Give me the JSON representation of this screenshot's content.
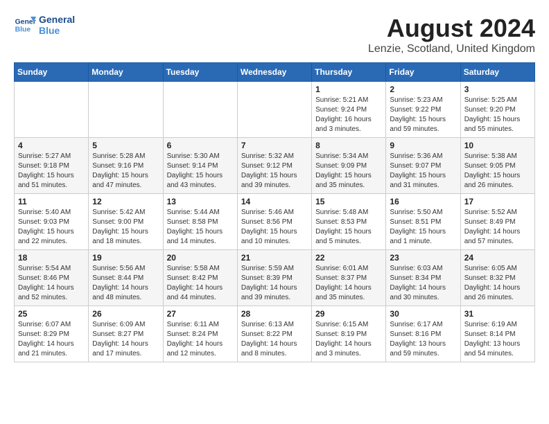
{
  "header": {
    "logo_line1": "General",
    "logo_line2": "Blue",
    "month_year": "August 2024",
    "location": "Lenzie, Scotland, United Kingdom"
  },
  "days_of_week": [
    "Sunday",
    "Monday",
    "Tuesday",
    "Wednesday",
    "Thursday",
    "Friday",
    "Saturday"
  ],
  "weeks": [
    [
      {
        "day": "",
        "content": ""
      },
      {
        "day": "",
        "content": ""
      },
      {
        "day": "",
        "content": ""
      },
      {
        "day": "",
        "content": ""
      },
      {
        "day": "1",
        "content": "Sunrise: 5:21 AM\nSunset: 9:24 PM\nDaylight: 16 hours\nand 3 minutes."
      },
      {
        "day": "2",
        "content": "Sunrise: 5:23 AM\nSunset: 9:22 PM\nDaylight: 15 hours\nand 59 minutes."
      },
      {
        "day": "3",
        "content": "Sunrise: 5:25 AM\nSunset: 9:20 PM\nDaylight: 15 hours\nand 55 minutes."
      }
    ],
    [
      {
        "day": "4",
        "content": "Sunrise: 5:27 AM\nSunset: 9:18 PM\nDaylight: 15 hours\nand 51 minutes."
      },
      {
        "day": "5",
        "content": "Sunrise: 5:28 AM\nSunset: 9:16 PM\nDaylight: 15 hours\nand 47 minutes."
      },
      {
        "day": "6",
        "content": "Sunrise: 5:30 AM\nSunset: 9:14 PM\nDaylight: 15 hours\nand 43 minutes."
      },
      {
        "day": "7",
        "content": "Sunrise: 5:32 AM\nSunset: 9:12 PM\nDaylight: 15 hours\nand 39 minutes."
      },
      {
        "day": "8",
        "content": "Sunrise: 5:34 AM\nSunset: 9:09 PM\nDaylight: 15 hours\nand 35 minutes."
      },
      {
        "day": "9",
        "content": "Sunrise: 5:36 AM\nSunset: 9:07 PM\nDaylight: 15 hours\nand 31 minutes."
      },
      {
        "day": "10",
        "content": "Sunrise: 5:38 AM\nSunset: 9:05 PM\nDaylight: 15 hours\nand 26 minutes."
      }
    ],
    [
      {
        "day": "11",
        "content": "Sunrise: 5:40 AM\nSunset: 9:03 PM\nDaylight: 15 hours\nand 22 minutes."
      },
      {
        "day": "12",
        "content": "Sunrise: 5:42 AM\nSunset: 9:00 PM\nDaylight: 15 hours\nand 18 minutes."
      },
      {
        "day": "13",
        "content": "Sunrise: 5:44 AM\nSunset: 8:58 PM\nDaylight: 15 hours\nand 14 minutes."
      },
      {
        "day": "14",
        "content": "Sunrise: 5:46 AM\nSunset: 8:56 PM\nDaylight: 15 hours\nand 10 minutes."
      },
      {
        "day": "15",
        "content": "Sunrise: 5:48 AM\nSunset: 8:53 PM\nDaylight: 15 hours\nand 5 minutes."
      },
      {
        "day": "16",
        "content": "Sunrise: 5:50 AM\nSunset: 8:51 PM\nDaylight: 15 hours\nand 1 minute."
      },
      {
        "day": "17",
        "content": "Sunrise: 5:52 AM\nSunset: 8:49 PM\nDaylight: 14 hours\nand 57 minutes."
      }
    ],
    [
      {
        "day": "18",
        "content": "Sunrise: 5:54 AM\nSunset: 8:46 PM\nDaylight: 14 hours\nand 52 minutes."
      },
      {
        "day": "19",
        "content": "Sunrise: 5:56 AM\nSunset: 8:44 PM\nDaylight: 14 hours\nand 48 minutes."
      },
      {
        "day": "20",
        "content": "Sunrise: 5:58 AM\nSunset: 8:42 PM\nDaylight: 14 hours\nand 44 minutes."
      },
      {
        "day": "21",
        "content": "Sunrise: 5:59 AM\nSunset: 8:39 PM\nDaylight: 14 hours\nand 39 minutes."
      },
      {
        "day": "22",
        "content": "Sunrise: 6:01 AM\nSunset: 8:37 PM\nDaylight: 14 hours\nand 35 minutes."
      },
      {
        "day": "23",
        "content": "Sunrise: 6:03 AM\nSunset: 8:34 PM\nDaylight: 14 hours\nand 30 minutes."
      },
      {
        "day": "24",
        "content": "Sunrise: 6:05 AM\nSunset: 8:32 PM\nDaylight: 14 hours\nand 26 minutes."
      }
    ],
    [
      {
        "day": "25",
        "content": "Sunrise: 6:07 AM\nSunset: 8:29 PM\nDaylight: 14 hours\nand 21 minutes."
      },
      {
        "day": "26",
        "content": "Sunrise: 6:09 AM\nSunset: 8:27 PM\nDaylight: 14 hours\nand 17 minutes."
      },
      {
        "day": "27",
        "content": "Sunrise: 6:11 AM\nSunset: 8:24 PM\nDaylight: 14 hours\nand 12 minutes."
      },
      {
        "day": "28",
        "content": "Sunrise: 6:13 AM\nSunset: 8:22 PM\nDaylight: 14 hours\nand 8 minutes."
      },
      {
        "day": "29",
        "content": "Sunrise: 6:15 AM\nSunset: 8:19 PM\nDaylight: 14 hours\nand 3 minutes."
      },
      {
        "day": "30",
        "content": "Sunrise: 6:17 AM\nSunset: 8:16 PM\nDaylight: 13 hours\nand 59 minutes."
      },
      {
        "day": "31",
        "content": "Sunrise: 6:19 AM\nSunset: 8:14 PM\nDaylight: 13 hours\nand 54 minutes."
      }
    ]
  ]
}
